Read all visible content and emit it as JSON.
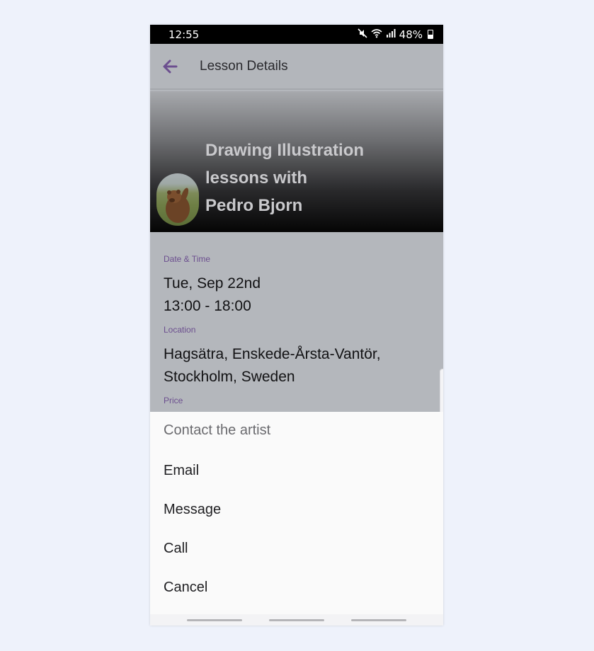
{
  "status_bar": {
    "time": "12:55",
    "battery": "48%",
    "icons": [
      "mute-icon",
      "wifi-icon",
      "signal-icon",
      "battery-icon"
    ]
  },
  "app_bar": {
    "title": "Lesson Details",
    "back_icon": "back-arrow-icon",
    "accent_color": "#6c4f8f"
  },
  "hero": {
    "title": "Drawing Illustration\nlessons with\nPedro Bjorn",
    "avatar": "avatar-bear-image"
  },
  "details": {
    "date_label": "Date & Time",
    "date": "Tue, Sep 22nd",
    "time": "13:00 - 18:00",
    "location_label": "Location",
    "location_line1": "Hagsätra, Enskede-Årsta-Vantör,",
    "location_line2": "Stockholm, Sweden",
    "price_label": "Price"
  },
  "sheet": {
    "title": "Contact the artist",
    "items": [
      "Email",
      "Message",
      "Call",
      "Cancel"
    ]
  }
}
